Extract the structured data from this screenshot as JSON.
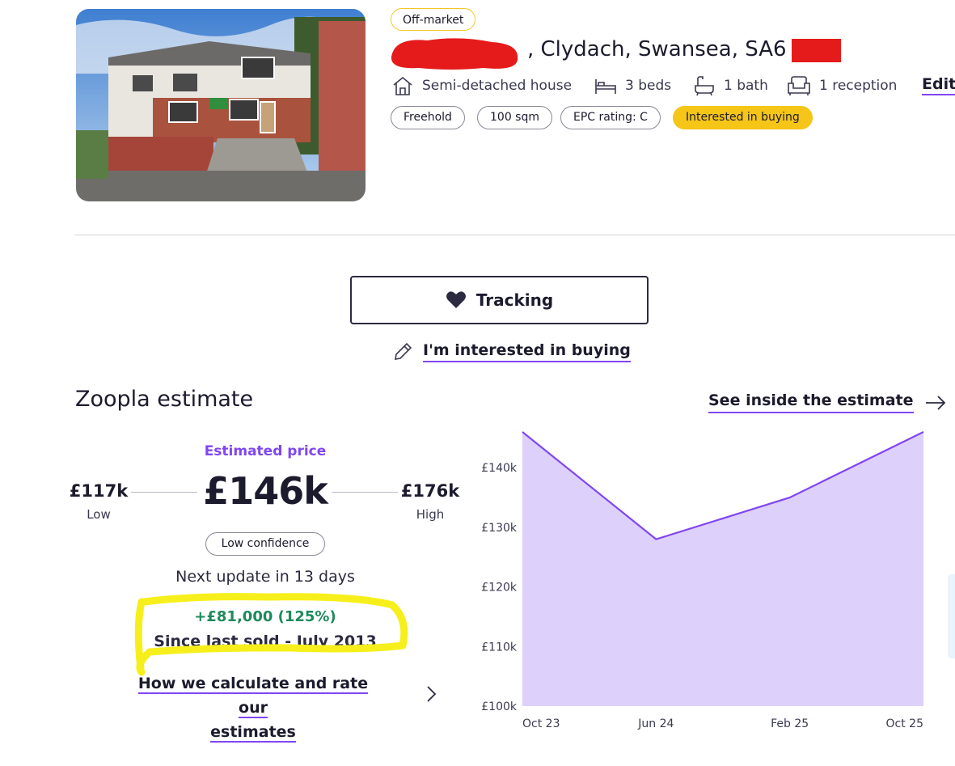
{
  "property": {
    "status_badge": "Off-market",
    "address_suffix": ", Clydach, Swansea, SA6",
    "features": [
      {
        "icon": "house-icon",
        "label": "Semi-detached house"
      },
      {
        "icon": "bed-icon",
        "label": "3  beds"
      },
      {
        "icon": "bath-icon",
        "label": "1  bath"
      },
      {
        "icon": "armchair-icon",
        "label": "1  reception"
      }
    ],
    "edit_label": "Edit",
    "tags": [
      "Freehold",
      "100 sqm",
      "EPC rating: C",
      "Interested in buying"
    ]
  },
  "actions": {
    "tracking_label": "Tracking",
    "interest_label": "I'm interested in buying"
  },
  "estimate": {
    "title": "Zoopla estimate",
    "see_inside_label": "See inside the estimate",
    "price_label": "Estimated price",
    "price": "£146k",
    "low_value": "£117k",
    "low_label": "Low",
    "high_value": "£176k",
    "high_label": "High",
    "confidence": "Low confidence",
    "next_update": "Next update in 13 days",
    "change": "+£81,000 (125%)",
    "since": "Since last sold - July 2013",
    "how_calc_line1": "How we calculate and rate our",
    "how_calc_line2": "estimates"
  },
  "colors": {
    "accent": "#8046f1",
    "area_fill": "#ddd0fb",
    "positive": "#1e8a5a",
    "tag_yellow": "#f5c518",
    "annotation_yellow": "#f7ef1c"
  },
  "chart_data": {
    "type": "area",
    "x": [
      "Oct 23",
      "Jun 24",
      "Feb 25",
      "Oct 25"
    ],
    "values": [
      146,
      128,
      135,
      146
    ],
    "yticks": [
      "£140k",
      "£130k",
      "£120k",
      "£110k",
      "£100k"
    ],
    "ytick_values": [
      140,
      130,
      120,
      110,
      100
    ],
    "ylim": [
      100,
      146
    ],
    "unit": "£k"
  }
}
